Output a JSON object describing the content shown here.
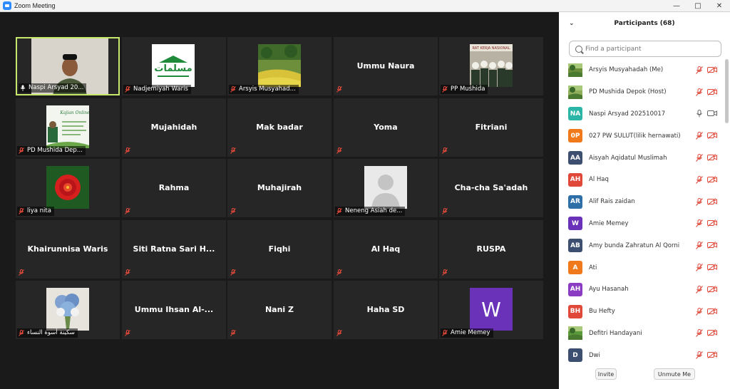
{
  "window": {
    "title": "Zoom Meeting"
  },
  "gallery": {
    "tiles": [
      {
        "label": "Naspi Arsyad 20...",
        "center": "",
        "pic": "person",
        "active": true,
        "mic": "on"
      },
      {
        "label": "Nadjemiyah Waris",
        "center": "",
        "pic": "logo",
        "active": false,
        "mic": "off"
      },
      {
        "label": "Arsyis Musyahad...",
        "center": "",
        "pic": "garden",
        "active": false,
        "mic": "off"
      },
      {
        "label": "",
        "center": "Ummu Naura",
        "pic": "",
        "active": false,
        "mic": "off"
      },
      {
        "label": "PP Mushida",
        "center": "",
        "pic": "group",
        "active": false,
        "mic": "off"
      },
      {
        "label": "PD Mushida Dep...",
        "center": "",
        "pic": "card",
        "active": false,
        "mic": "off"
      },
      {
        "label": "",
        "center": "Mujahidah",
        "pic": "",
        "active": false,
        "mic": "off"
      },
      {
        "label": "",
        "center": "Mak badar",
        "pic": "",
        "active": false,
        "mic": "off"
      },
      {
        "label": "",
        "center": "Yoma",
        "pic": "",
        "active": false,
        "mic": "off"
      },
      {
        "label": "",
        "center": "Fitriani",
        "pic": "",
        "active": false,
        "mic": "off"
      },
      {
        "label": "liya nita",
        "center": "",
        "pic": "flower",
        "active": false,
        "mic": "off"
      },
      {
        "label": "",
        "center": "Rahma",
        "pic": "",
        "active": false,
        "mic": "off"
      },
      {
        "label": "",
        "center": "Muhajirah",
        "pic": "",
        "active": false,
        "mic": "off"
      },
      {
        "label": "Neneng Asiah de...",
        "center": "",
        "pic": "silhouette",
        "active": false,
        "mic": "off"
      },
      {
        "label": "",
        "center": "Cha-cha Sa'adah",
        "pic": "",
        "active": false,
        "mic": "off"
      },
      {
        "label": "",
        "center": "Khairunnisa Waris",
        "pic": "",
        "active": false,
        "mic": "off"
      },
      {
        "label": "",
        "center": "Siti Ratna Sari H...",
        "pic": "",
        "active": false,
        "mic": "off"
      },
      {
        "label": "",
        "center": "Fiqhi",
        "pic": "",
        "active": false,
        "mic": "off"
      },
      {
        "label": "",
        "center": "Al Haq",
        "pic": "",
        "active": false,
        "mic": "off"
      },
      {
        "label": "",
        "center": "RUSPA",
        "pic": "",
        "active": false,
        "mic": "off"
      },
      {
        "label": "سكينة أسوة النساء",
        "center": "",
        "pic": "bouquet",
        "active": false,
        "mic": "off"
      },
      {
        "label": "",
        "center": "Ummu Ihsan Al-...",
        "pic": "",
        "active": false,
        "mic": "off"
      },
      {
        "label": "",
        "center": "Nani Z",
        "pic": "",
        "active": false,
        "mic": "off"
      },
      {
        "label": "",
        "center": "Haha SD",
        "pic": "",
        "active": false,
        "mic": "off"
      },
      {
        "label": "Amie Memey",
        "center": "",
        "pic": "letter-w",
        "active": false,
        "mic": "off"
      }
    ],
    "logo_text": "مسلمات",
    "letter_w": "W"
  },
  "participants": {
    "header": "Participants (68)",
    "search_placeholder": "Find a participant",
    "list": [
      {
        "initials": "",
        "color": "#6b8e3a",
        "img": true,
        "name": "Arsyis Musyahadah (Me)",
        "mic": "off"
      },
      {
        "initials": "",
        "color": "#8fae5a",
        "img": true,
        "name": "PD Mushida Depok (Host)",
        "mic": "off"
      },
      {
        "initials": "NA",
        "color": "#2bb5a6",
        "img": false,
        "name": "Naspi Arsyad 202510017",
        "mic": "on"
      },
      {
        "initials": "0P",
        "color": "#f07a1b",
        "img": false,
        "name": "027 PW SULUT(lilik hernawati)",
        "mic": "off"
      },
      {
        "initials": "AA",
        "color": "#3d4f70",
        "img": false,
        "name": "Aisyah Aqidatul Muslimah",
        "mic": "off"
      },
      {
        "initials": "AH",
        "color": "#e0493a",
        "img": false,
        "name": "Al Haq",
        "mic": "off"
      },
      {
        "initials": "AR",
        "color": "#2f6fa8",
        "img": false,
        "name": "Alif Rais zaidan",
        "mic": "off"
      },
      {
        "initials": "W",
        "color": "#6a32b8",
        "img": false,
        "name": "Amie Memey",
        "mic": "off"
      },
      {
        "initials": "AB",
        "color": "#3d4f70",
        "img": false,
        "name": "Amy bunda Zahratun Al Qorni",
        "mic": "off"
      },
      {
        "initials": "A",
        "color": "#f07a1b",
        "img": false,
        "name": "Ati",
        "mic": "off"
      },
      {
        "initials": "AH",
        "color": "#8a3cc2",
        "img": false,
        "name": "Ayu Hasanah",
        "mic": "off"
      },
      {
        "initials": "BH",
        "color": "#e0493a",
        "img": false,
        "name": "Bu Hefty",
        "mic": "off"
      },
      {
        "initials": "",
        "color": "#5a9a3a",
        "img": true,
        "name": "Defitri Handayani",
        "mic": "off"
      },
      {
        "initials": "D",
        "color": "#3d4f70",
        "img": false,
        "name": "Dwi",
        "mic": "off"
      }
    ],
    "invite_label": "Invite",
    "unmute_label": "Unmute Me"
  },
  "colors": {
    "active_border": "#c7e86b",
    "muted_red": "#e0493a",
    "tile_bg": "#262626"
  }
}
